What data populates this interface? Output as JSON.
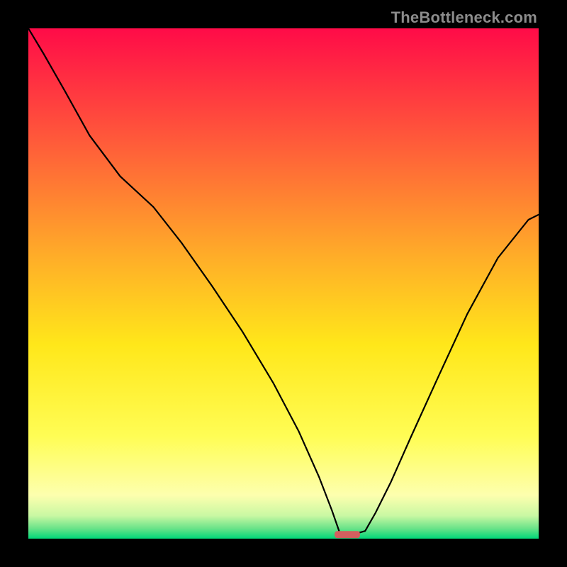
{
  "watermark": "TheBottleneck.com",
  "chart_data": {
    "type": "line",
    "title": "",
    "xlabel": "",
    "ylabel": "",
    "xlim": [
      0,
      100
    ],
    "ylim": [
      0,
      100
    ],
    "grid": false,
    "legend": false,
    "background_gradient": {
      "stops": [
        {
          "pos": 0.0,
          "color": "#ff0b48"
        },
        {
          "pos": 0.22,
          "color": "#ff5a3a"
        },
        {
          "pos": 0.45,
          "color": "#ffae28"
        },
        {
          "pos": 0.62,
          "color": "#ffe71a"
        },
        {
          "pos": 0.8,
          "color": "#fffd55"
        },
        {
          "pos": 0.915,
          "color": "#fdffae"
        },
        {
          "pos": 0.955,
          "color": "#c9f8a3"
        },
        {
          "pos": 0.98,
          "color": "#6ae389"
        },
        {
          "pos": 1.0,
          "color": "#00d879"
        }
      ]
    },
    "marker": {
      "x": 62.5,
      "y": 0.8,
      "width": 5.0,
      "height": 1.4,
      "color": "#d35f5f",
      "rx": 4
    },
    "series": [
      {
        "name": "bottleneck-curve",
        "color": "#000000",
        "stroke_width": 2.2,
        "x": [
          0.0,
          3.0,
          7.0,
          12.0,
          18.0,
          24.5,
          30.0,
          36.0,
          42.0,
          48.0,
          53.0,
          57.0,
          59.5,
          61.0,
          63.5,
          66.0,
          68.0,
          71.0,
          75.0,
          80.0,
          86.0,
          92.0,
          98.0,
          100.0
        ],
        "y": [
          100.0,
          95.0,
          88.0,
          79.0,
          71.0,
          65.0,
          58.0,
          49.5,
          40.5,
          30.5,
          21.0,
          12.0,
          5.5,
          1.2,
          0.8,
          1.5,
          5.0,
          11.0,
          20.0,
          31.0,
          44.0,
          55.0,
          62.5,
          63.5
        ]
      }
    ]
  }
}
